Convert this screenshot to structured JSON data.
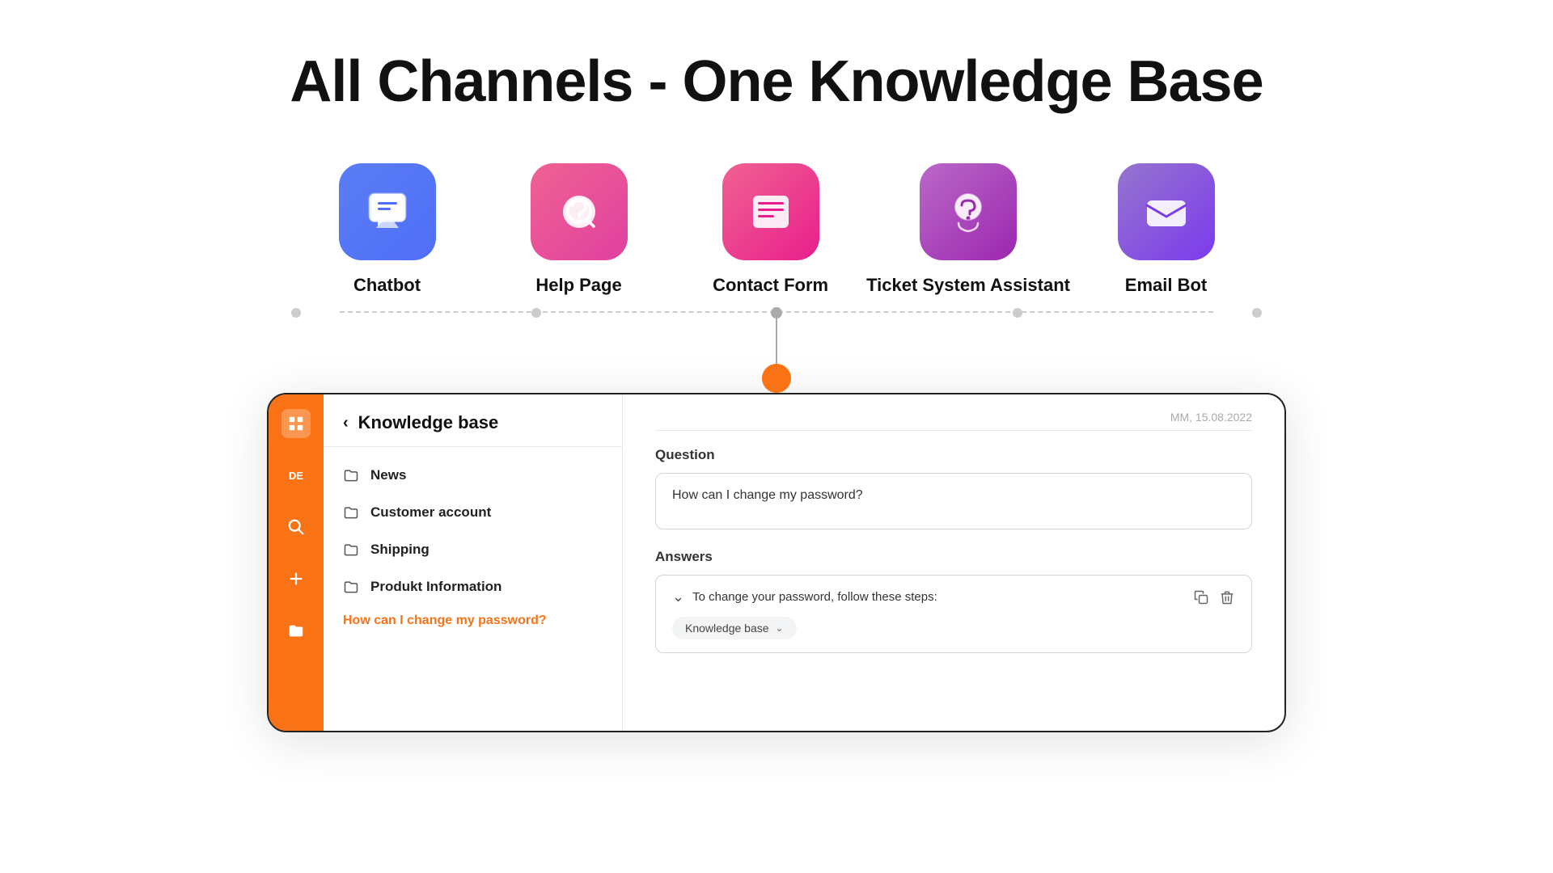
{
  "hero": {
    "title": "All Channels - One Knowledge Base"
  },
  "channels": [
    {
      "id": "chatbot",
      "label": "Chatbot",
      "bg_color": "#4f6ef7",
      "icon": "chatbot"
    },
    {
      "id": "help-page",
      "label": "Help Page",
      "bg_color": "#e040a0",
      "icon": "help-page"
    },
    {
      "id": "contact-form",
      "label": "Contact Form",
      "bg_color": "#e0387a",
      "icon": "contact-form"
    },
    {
      "id": "ticket-system",
      "label": "Ticket System Assistant",
      "bg_color": "#9c27b0",
      "icon": "ticket-system"
    },
    {
      "id": "email-bot",
      "label": "Email Bot",
      "bg_color": "#7c3aed",
      "icon": "email-bot"
    }
  ],
  "app": {
    "sidebar": {
      "lang": "DE",
      "icons": [
        "grid",
        "search",
        "plus",
        "folder"
      ]
    },
    "left_panel": {
      "title": "Knowledge base",
      "nav_items": [
        {
          "label": "News"
        },
        {
          "label": "Customer account"
        },
        {
          "label": "Shipping"
        },
        {
          "label": "Produkt Information"
        }
      ],
      "active_item": "How can I change my password?"
    },
    "right_panel": {
      "date": "MM, 15.08.2022",
      "question_label": "Question",
      "question_text": "How can I change my password?",
      "answers_label": "Answers",
      "answer_text": "To change your password, follow these steps:",
      "answer_tag": "Knowledge base"
    }
  }
}
